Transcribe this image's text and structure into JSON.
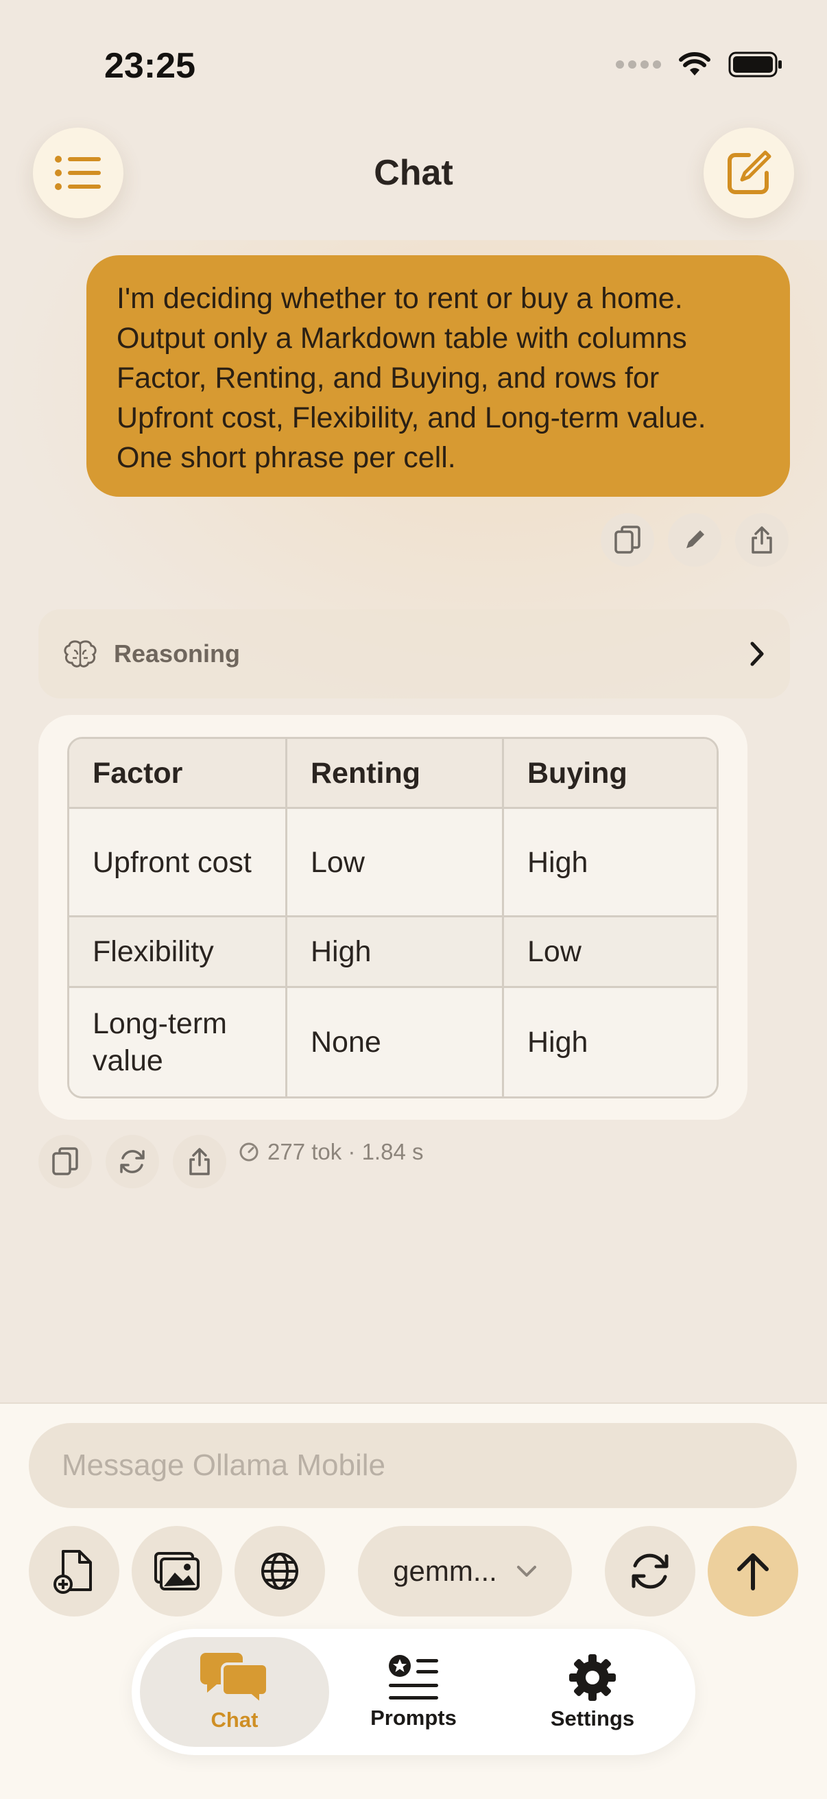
{
  "status_bar": {
    "time": "23:25"
  },
  "header": {
    "title": "Chat"
  },
  "user_message": {
    "text": "I'm deciding whether to rent or buy a home. Output only a Markdown table with columns Factor, Renting, and Buying, and rows for Upfront cost, Flexibility, and Long-term value. One short phrase per cell."
  },
  "reasoning": {
    "label": "Reasoning"
  },
  "answer": {
    "columns": [
      "Factor",
      "Renting",
      "Buying"
    ],
    "rows": [
      [
        "Upfront cost",
        "Low",
        "High"
      ],
      [
        "Flexibility",
        "High",
        "Low"
      ],
      [
        "Long-term value",
        "None",
        "High"
      ]
    ],
    "stats": "277 tok · 1.84 s"
  },
  "composer": {
    "placeholder": "Message Ollama Mobile",
    "model": "gemm..."
  },
  "tabs": [
    {
      "label": "Chat",
      "active": true
    },
    {
      "label": "Prompts",
      "active": false
    },
    {
      "label": "Settings",
      "active": false
    }
  ],
  "colors": {
    "accent": "#d79a32",
    "background": "#f0e8df",
    "active_tab_text": "#cf8f24"
  }
}
